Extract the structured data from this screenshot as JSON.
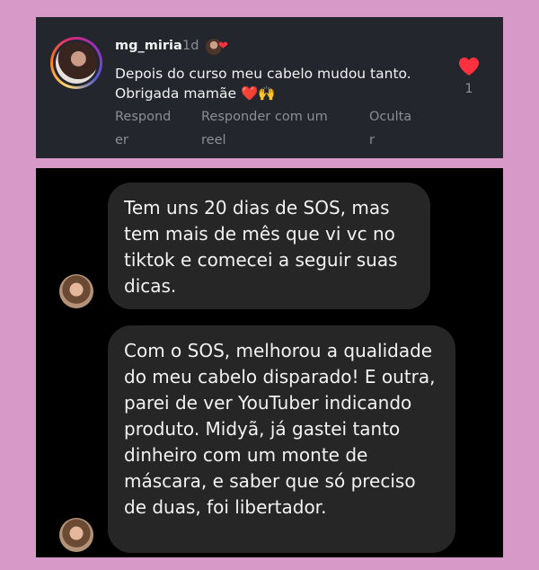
{
  "comment": {
    "username": "mg_miria",
    "time": "1d",
    "text": "Depois do curso meu cabelo mudou tanto.  Obrigada mamãe ❤️🙌",
    "actions": {
      "reply_line1": "Respond",
      "reply_line2": "er",
      "reel_line1": "Responder com um",
      "reel_line2": "reel",
      "hide_line1": "Oculta",
      "hide_line2": "r"
    },
    "like_count": "1",
    "colors": {
      "heart": "#ff3040",
      "card_bg": "#24262d",
      "muted_text": "#8b8e95"
    },
    "icons": [
      "heart-icon",
      "author-liked-heart-icon"
    ]
  },
  "chat": {
    "messages": [
      {
        "text": "Tem uns 20 dias de SOS, mas tem mais de mês que vi vc no tiktok e comecei a seguir suas dicas."
      },
      {
        "text": "Com o SOS, melhorou a qualidade do meu cabelo disparado! E outra, parei de ver YouTuber indicando produto. Midyã, já gastei tanto dinheiro com um monte de máscara, e saber que só preciso de duas, foi libertador."
      }
    ],
    "colors": {
      "bubble_bg": "#262626",
      "chat_bg": "#000000"
    }
  }
}
